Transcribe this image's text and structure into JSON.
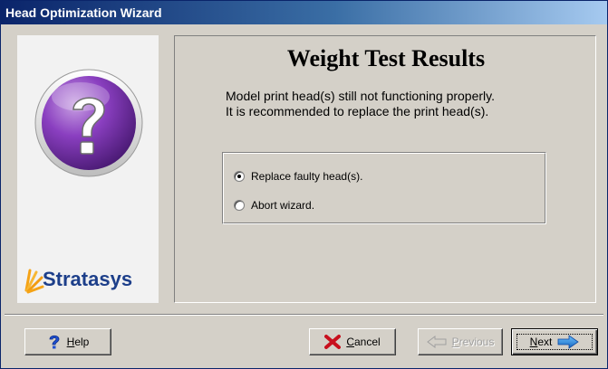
{
  "window": {
    "title": "Head Optimization Wizard"
  },
  "sidebar": {
    "icon": "question-mark-icon",
    "logo_text": "Stratasys",
    "logo_icon": "stratasys-burst-icon"
  },
  "main": {
    "heading": "Weight Test Results",
    "message_line1": "Model print head(s) still not functioning properly.",
    "message_line2": "It is recommended to replace the print head(s)."
  },
  "options": [
    {
      "label": "Replace faulty head(s).",
      "selected": true
    },
    {
      "label": "Abort wizard.",
      "selected": false
    }
  ],
  "buttons": {
    "help": {
      "mnemonic": "H",
      "rest": "elp",
      "icon": "help-icon"
    },
    "cancel": {
      "mnemonic": "C",
      "rest": "ancel",
      "icon": "red-x-icon"
    },
    "previous": {
      "mnemonic": "P",
      "rest": "revious",
      "icon": "back-arrow-icon",
      "disabled": true
    },
    "next": {
      "mnemonic": "N",
      "rest": "ext",
      "icon": "forward-arrow-icon"
    }
  },
  "colors": {
    "title_start": "#0a246a",
    "title_end": "#a6caf0",
    "face": "#d4d0c8",
    "logo_blue": "#1d3f8a",
    "logo_orange": "#f5a316"
  }
}
